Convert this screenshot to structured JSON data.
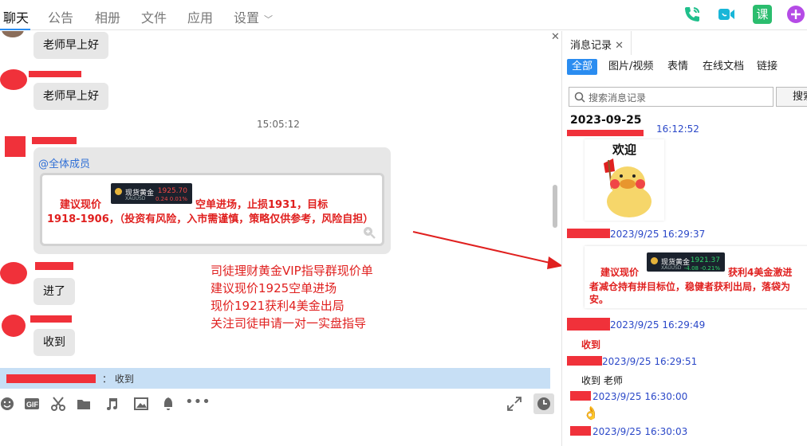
{
  "nav": {
    "items": [
      {
        "label": "聊天",
        "active": true
      },
      {
        "label": "公告"
      },
      {
        "label": "相册"
      },
      {
        "label": "文件"
      },
      {
        "label": "应用"
      },
      {
        "label": "设置"
      }
    ],
    "right_icons": [
      "phone-call-icon",
      "video-call-icon",
      "lesson-icon",
      "add-icon"
    ],
    "lesson_label": "课"
  },
  "chat": {
    "messages": [
      {
        "text": "老师早上好"
      },
      {
        "text": "老师早上好"
      },
      {
        "text": "进了"
      },
      {
        "text": "收到"
      }
    ],
    "timestamp": "15:05:12",
    "card": {
      "mention": "@全体成员",
      "prefix": "建议现价",
      "line1": "空单进场，止损1931，目标",
      "line2": "1918-1906，（投资有风险，入市需谨慎，策略仅供参考，风险自担）",
      "ticker": {
        "name": "现货黄金",
        "price": "1925.70",
        "sub": "XAUUSD",
        "change": "0.24  0.01%"
      }
    },
    "annotation": [
      "司徒理财黄金VIP指导群现价单",
      "建议现价1925空单进场",
      "现价1921获利4美金出局",
      "关注司徒申请一对一实盘指导"
    ],
    "reply_preview": "： 收到"
  },
  "colors": {
    "accent": "#2a8cf0",
    "alert": "#e0201f",
    "redact": "#f0313a",
    "bubble": "#e7e7e7",
    "reply_bar": "#c7dff5"
  },
  "history": {
    "tab_label": "消息记录",
    "filters": [
      "全部",
      "图片/视频",
      "表情",
      "在线文档",
      "链接"
    ],
    "search_placeholder": "搜索消息记录",
    "search_button": "搜索",
    "date": "2023-09-25",
    "first_time": "16:12:52",
    "sticker_text": "欢迎",
    "entries": [
      {
        "time": "2023/9/25 16:29:37"
      },
      {
        "time": "2023/9/25 16:29:49",
        "text": "收到"
      },
      {
        "time": "2023/9/25 16:29:51",
        "text": "收到 老师"
      },
      {
        "time": "2023/9/25 16:30:00",
        "text": "👌"
      },
      {
        "time": "2023/9/25 16:30:03"
      }
    ],
    "card": {
      "prefix": "建议现价",
      "line1": "获利4美金激进",
      "line2": "者减仓持有拼目标位，稳健者获利出局，落袋为",
      "line3": "安。",
      "ticker": {
        "name": "现货黄金",
        "price": "1921.37",
        "sub": "XAUUSD",
        "change": "-4.08  -0.21%"
      }
    }
  }
}
